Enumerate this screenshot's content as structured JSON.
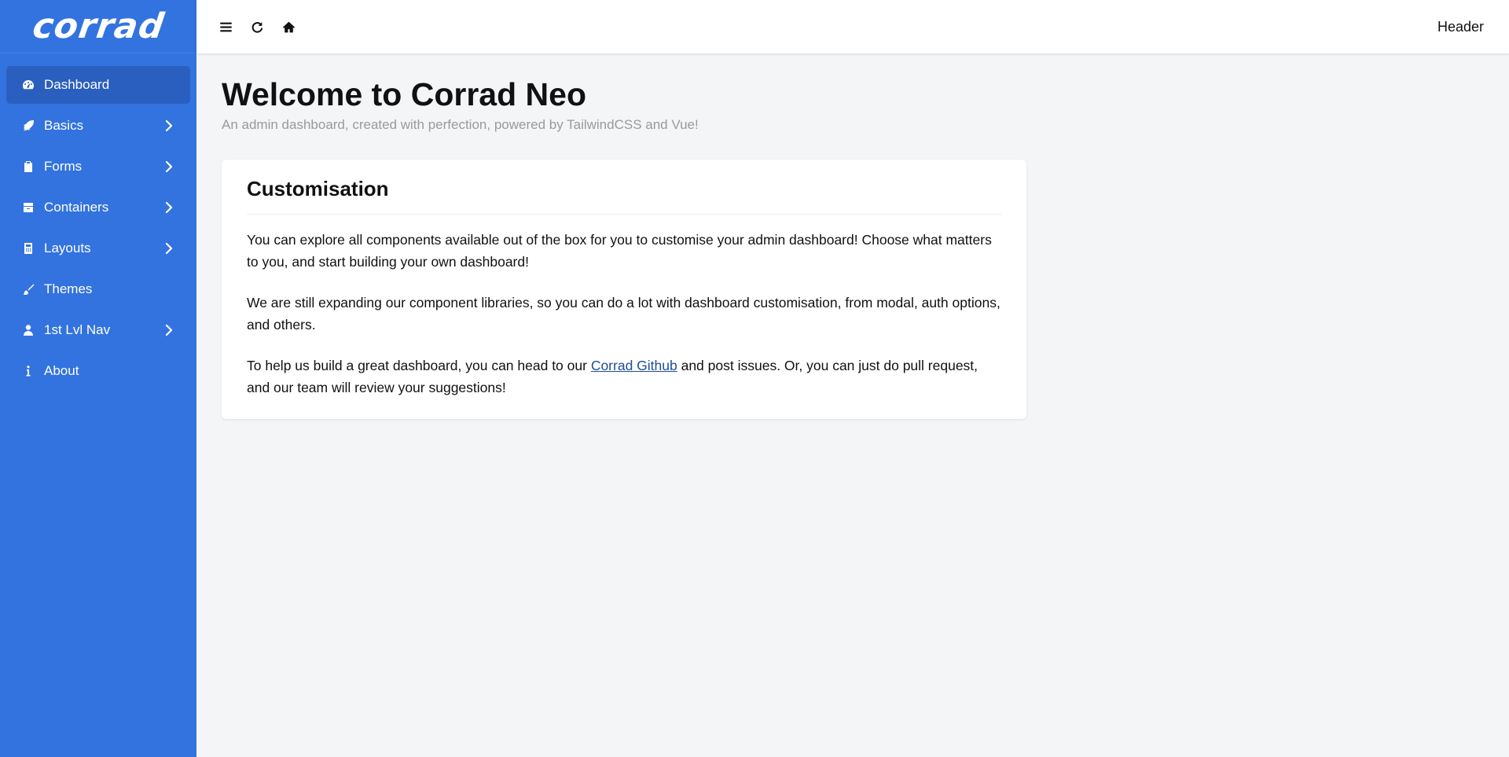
{
  "brand": {
    "logo_text": "corrad"
  },
  "sidebar": {
    "items": [
      {
        "label": "Dashboard",
        "icon": "dashboard-gauge-icon",
        "has_children": false,
        "active": true
      },
      {
        "label": "Basics",
        "icon": "rocket-icon",
        "has_children": true,
        "active": false
      },
      {
        "label": "Forms",
        "icon": "clipboard-icon",
        "has_children": true,
        "active": false
      },
      {
        "label": "Containers",
        "icon": "box-icon",
        "has_children": true,
        "active": false
      },
      {
        "label": "Layouts",
        "icon": "calculator-icon",
        "has_children": true,
        "active": false
      },
      {
        "label": "Themes",
        "icon": "brush-icon",
        "has_children": false,
        "active": false
      },
      {
        "label": "1st Lvl Nav",
        "icon": "user-icon",
        "has_children": true,
        "active": false
      },
      {
        "label": "About",
        "icon": "info-icon",
        "has_children": false,
        "active": false
      }
    ]
  },
  "header": {
    "buttons": [
      "menu-icon",
      "refresh-icon",
      "home-icon"
    ],
    "right_text": "Header"
  },
  "main": {
    "title": "Welcome to Corrad Neo",
    "subtitle": "An admin dashboard, created with perfection, powered by TailwindCSS and Vue!",
    "card": {
      "title": "Customisation",
      "p1": "You can explore all components available out of the box for you to customise your admin dashboard! Choose what matters to you, and start building your own dashboard!",
      "p2": "We are still expanding our component libraries, so you can do a lot with dashboard customisation, from modal, auth options, and others.",
      "p3_before": "To help us build a great dashboard, you can head to our ",
      "p3_link": "Corrad Github",
      "p3_after": " and post issues. Or, you can just do pull request, and our team will review your suggestions!"
    }
  },
  "colors": {
    "sidebar_bg": "#3373e0",
    "sidebar_active": "#2a5fc0",
    "page_bg": "#f4f5f7",
    "link": "#1d4e9a"
  }
}
